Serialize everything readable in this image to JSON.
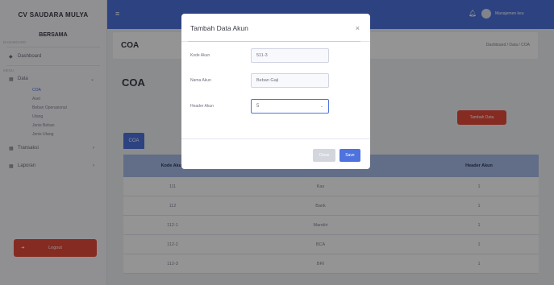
{
  "sidebar": {
    "brand": "CV SAUDARA MULYA",
    "brand_sub": "BERSAMA",
    "section_dashboard": "DASHBOARD",
    "dashboard_label": "Dashboard",
    "section_main": "MENU",
    "data_label": "Data",
    "sub_items": [
      "COA",
      "Aset",
      "Beban Operasional",
      "Utang",
      "Jenis Beban",
      "Jenis Utang"
    ],
    "transaksi_label": "Transaksi",
    "laporan_label": "Laporan",
    "logout_label": "Logout"
  },
  "topbar": {
    "user_name": "Manajemen keu"
  },
  "page": {
    "header_title": "COA",
    "breadcrumb": "Dashboard / Data / COA",
    "content_title": "COA",
    "add_button": "Tambah Data",
    "tab_label": "COA"
  },
  "table": {
    "headers": [
      "Kode Akun",
      "Nama Akun",
      "Header Akun"
    ],
    "rows": [
      [
        "111",
        "Kas",
        "1"
      ],
      [
        "112",
        "Bank",
        "1"
      ],
      [
        "112-1",
        "Mandiri",
        "1"
      ],
      [
        "112-2",
        "BCA",
        "1"
      ],
      [
        "112-3",
        "BRI",
        "1"
      ]
    ]
  },
  "modal": {
    "title": "Tambah Data Akun",
    "close_symbol": "×",
    "kode_label": "Kode Akun",
    "kode_value": "511-3",
    "nama_label": "Nama Akun",
    "nama_value": "Beban Gaji",
    "header_label": "Header Akun",
    "header_value": "5",
    "close_button": "Close",
    "save_button": "Save"
  },
  "colors": {
    "primary": "#4e73df",
    "danger": "#e74a3b"
  }
}
